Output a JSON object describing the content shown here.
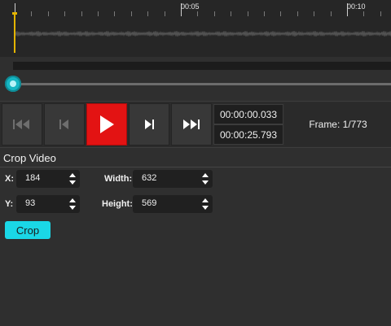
{
  "timeline": {
    "tick_labels": [
      "00:05",
      "00:10"
    ]
  },
  "transport": {
    "current_time": "00:00:00.033",
    "total_time": "00:00:25.793",
    "frame_label": "Frame: 1/773"
  },
  "crop": {
    "header": "Crop Video",
    "x_label": "X:",
    "x_value": "184",
    "y_label": "Y:",
    "y_value": "93",
    "width_label": "Width:",
    "width_value": "632",
    "height_label": "Height:",
    "height_value": "569",
    "button_label": "Crop"
  },
  "colors": {
    "accent": "#1ad7e6",
    "play_button": "#e31313",
    "playhead": "#e3b400"
  },
  "icons": [
    "skip-to-start-icon",
    "step-back-icon",
    "play-icon",
    "step-forward-icon",
    "skip-to-end-icon",
    "spin-arrows-icon"
  ]
}
